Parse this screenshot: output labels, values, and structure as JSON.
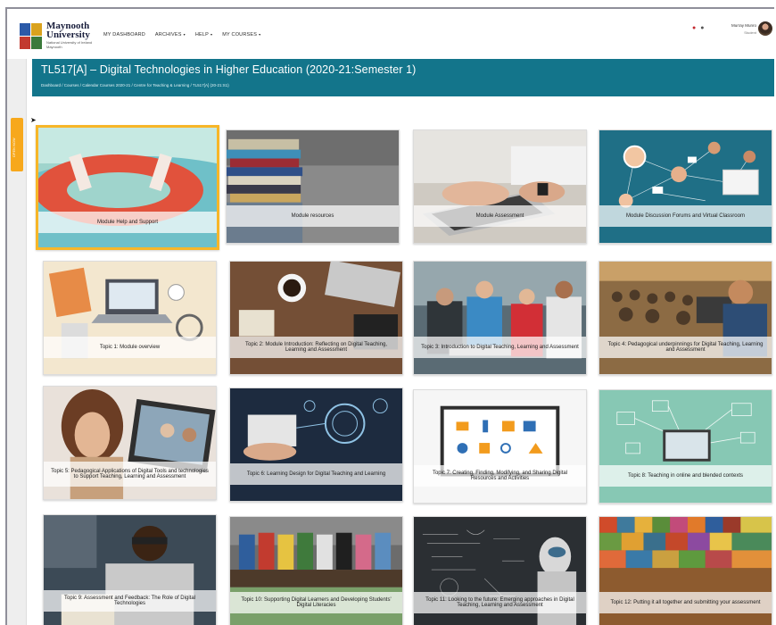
{
  "brand": {
    "name": "Maynooth University",
    "subtitle": "National University of Ireland Maynooth"
  },
  "nav": {
    "items": [
      {
        "label": "MY DASHBOARD",
        "caret": ""
      },
      {
        "label": "ARCHIVES",
        "caret": "▾"
      },
      {
        "label": "HELP",
        "caret": "▾"
      },
      {
        "label": "MY COURSES",
        "caret": "▾"
      }
    ],
    "user_name": "Murray Munro",
    "user_role": "Student"
  },
  "drawer": {
    "label": "OPEN NOW"
  },
  "course": {
    "title": "TL517[A] – Digital Technologies in Higher Education (2020-21:Semester 1)",
    "breadcrumb": "Dashboard / Courses / Calendar Courses 2020-21 / Centre for Teaching & Learning / TL517[A] (20-21:S1)"
  },
  "tiles": [
    {
      "label": "Module Help and Support",
      "icon": "life-ring-image",
      "selected": true
    },
    {
      "label": "Module resources",
      "icon": "book-stack-image",
      "selected": false
    },
    {
      "label": "Module Assessment",
      "icon": "typing-laptop-image",
      "selected": false
    },
    {
      "label": "Module Discussion Forums and Virtual Classroom",
      "icon": "network-people-image",
      "selected": false
    },
    {
      "label": "Topic 1: Module overview",
      "icon": "desk-laptop-image",
      "selected": false
    },
    {
      "label": "Topic 2: Module Introduction: Reflecting on Digital Teaching, Learning and Assessment",
      "icon": "coffee-desk-image",
      "selected": false
    },
    {
      "label": "Topic 3: Introduction to Digital Teaching, Learning and Assessment",
      "icon": "students-laptop-image",
      "selected": false
    },
    {
      "label": "Topic 4: Pedagogical underpinnings for Digital Teaching, Learning and Assessment",
      "icon": "lecture-hall-image",
      "selected": false
    },
    {
      "label": "Topic 5: Pedagogical Applications of Digital Tools and technologies to Support Teaching, Learning and Assessment",
      "icon": "video-call-image",
      "selected": false
    },
    {
      "label": "Topic 6: Learning Design for Digital Teaching and Learning",
      "icon": "digital-design-image",
      "selected": false
    },
    {
      "label": "Topic 7: Creating, Finding, Modifying, and Sharing Digital Resources and Activities",
      "icon": "media-icons-image",
      "selected": false
    },
    {
      "label": "Topic 8: Teaching in online and blended contexts",
      "icon": "online-teaching-image",
      "selected": false
    },
    {
      "label": "Topic 9: Assessment and Feedback: The Role of Digital Technologies",
      "icon": "student-study-image",
      "selected": false
    },
    {
      "label": "Topic 10: Supporting Digital Learners and Developing Students' Digital Literacies",
      "icon": "students-bench-image",
      "selected": false
    },
    {
      "label": "Topic 11: Looking to the future: Emerging approaches in Digital Teaching, Learning and Assessment",
      "icon": "robot-chalkboard-image",
      "selected": false
    },
    {
      "label": "Topic 12: Putting it all together and submitting your assessment",
      "icon": "jigsaw-image",
      "selected": false
    }
  ]
}
